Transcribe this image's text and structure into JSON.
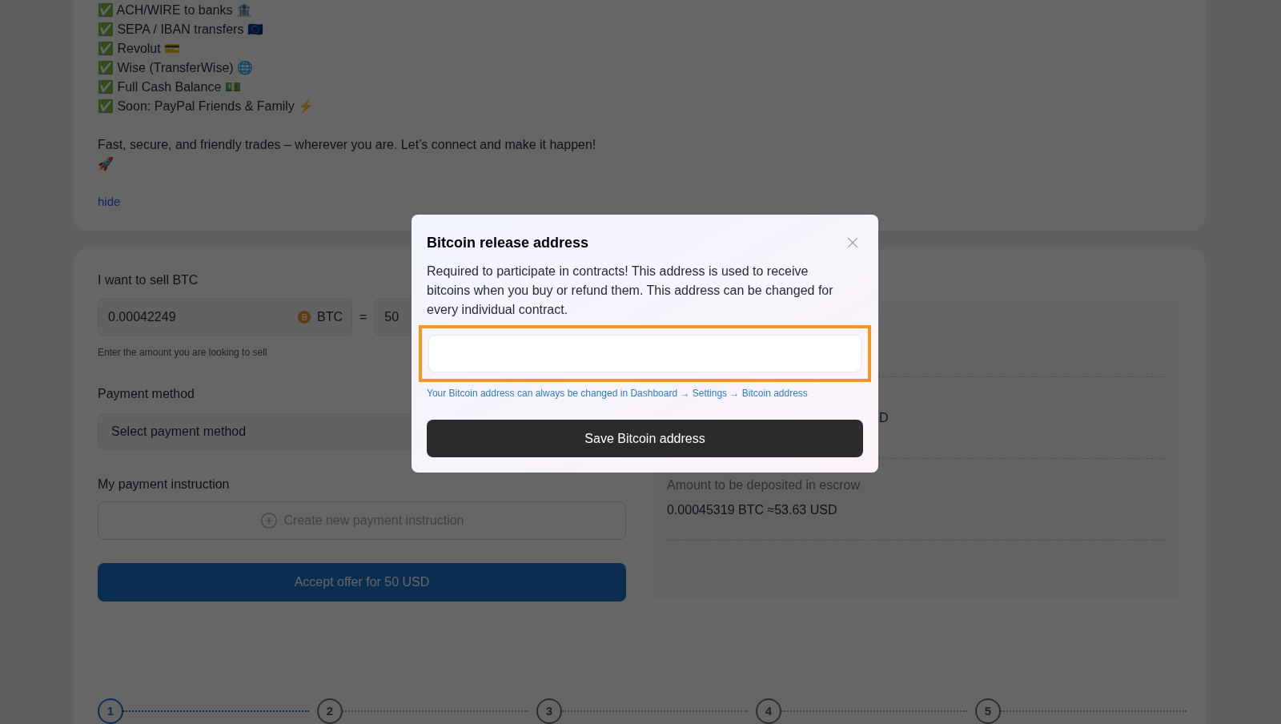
{
  "offer_description": {
    "items": [
      "✅ ACH/WIRE to banks 🏦",
      "✅ SEPA / IBAN transfers 🇪🇺",
      "✅ Revolut 💳",
      "✅ Wise (TransferWise) 🌐",
      "✅ Full Cash Balance 💵",
      "✅ Soon: PayPal Friends & Family ⚡"
    ],
    "text": "Fast, secure, and friendly trades – wherever you are. Let’s connect and make it happen!",
    "emoji": "🚀",
    "toggle": "hide"
  },
  "sell_form": {
    "amount_label": "I want to sell BTC",
    "amount": "0.00042249",
    "currency": "BTC",
    "equals": "=",
    "fiat_amount": "50",
    "amount_hint": "Enter the amount you are looking to sell",
    "payment_method_label": "Payment method",
    "payment_method_placeholder": "Select payment method",
    "instruction_label": "My payment instruction",
    "create_instruction": "Create new payment instruction",
    "accept_button": "Accept offer for 50 USD"
  },
  "summary": {
    "row_fragment": "D",
    "escrow_label": "Amount to be deposited in escrow",
    "escrow_value": "0.00045319 BTC ≈53.63 USD"
  },
  "steps": [
    {
      "label": "1",
      "selected": true
    },
    {
      "label": "2",
      "selected": false
    },
    {
      "label": "3",
      "selected": false
    },
    {
      "label": "4",
      "selected": false
    },
    {
      "label": "5",
      "selected": false
    }
  ],
  "modal": {
    "title": "Bitcoin release address",
    "description": "Required to participate in contracts! This address is used to receive bitcoins when you buy or refund them. This address can be changed for every individual contract.",
    "field_highlighted": true,
    "helper": "Your Bitcoin address can always be changed in Dashboard → Settings → Bitcoin address",
    "save_button": "Save Bitcoin address"
  }
}
